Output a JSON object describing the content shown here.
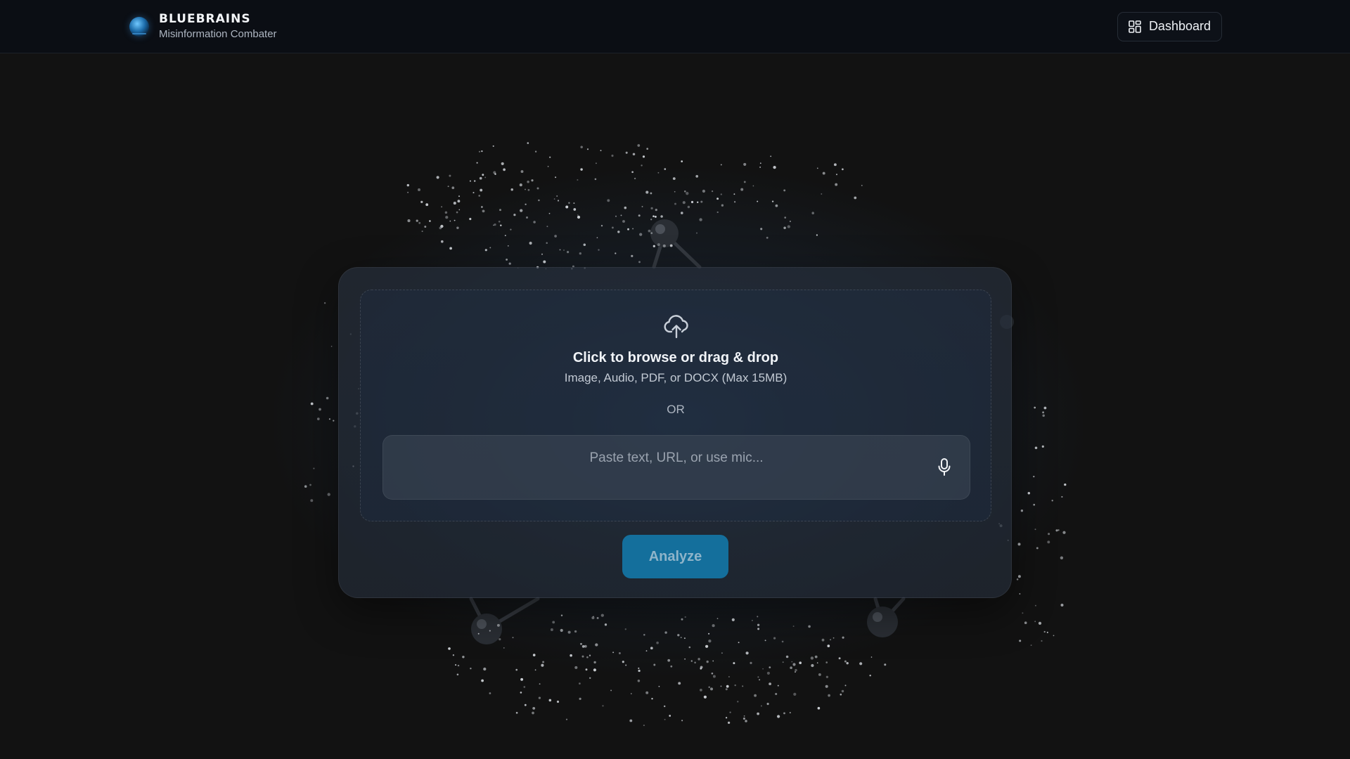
{
  "header": {
    "brand_title": "BLUEBRAINS",
    "brand_subtitle": "Misinformation Combater",
    "dashboard_label": "Dashboard"
  },
  "upload": {
    "title": "Click to browse or drag & drop",
    "subtitle": "Image, Audio, PDF, or DOCX (Max 15MB)",
    "or_label": "OR",
    "input_placeholder": "Paste text, URL, or use mic...",
    "input_value": ""
  },
  "actions": {
    "analyze_label": "Analyze"
  },
  "icons": {
    "logo": "brain-globe-logo",
    "dashboard": "grid-icon",
    "upload": "cloud-upload-icon",
    "mic": "microphone-icon"
  },
  "colors": {
    "background": "#121212",
    "header_bg": "#0b0e14",
    "card_bg": "#262e3a",
    "accent": "#146f9c"
  }
}
